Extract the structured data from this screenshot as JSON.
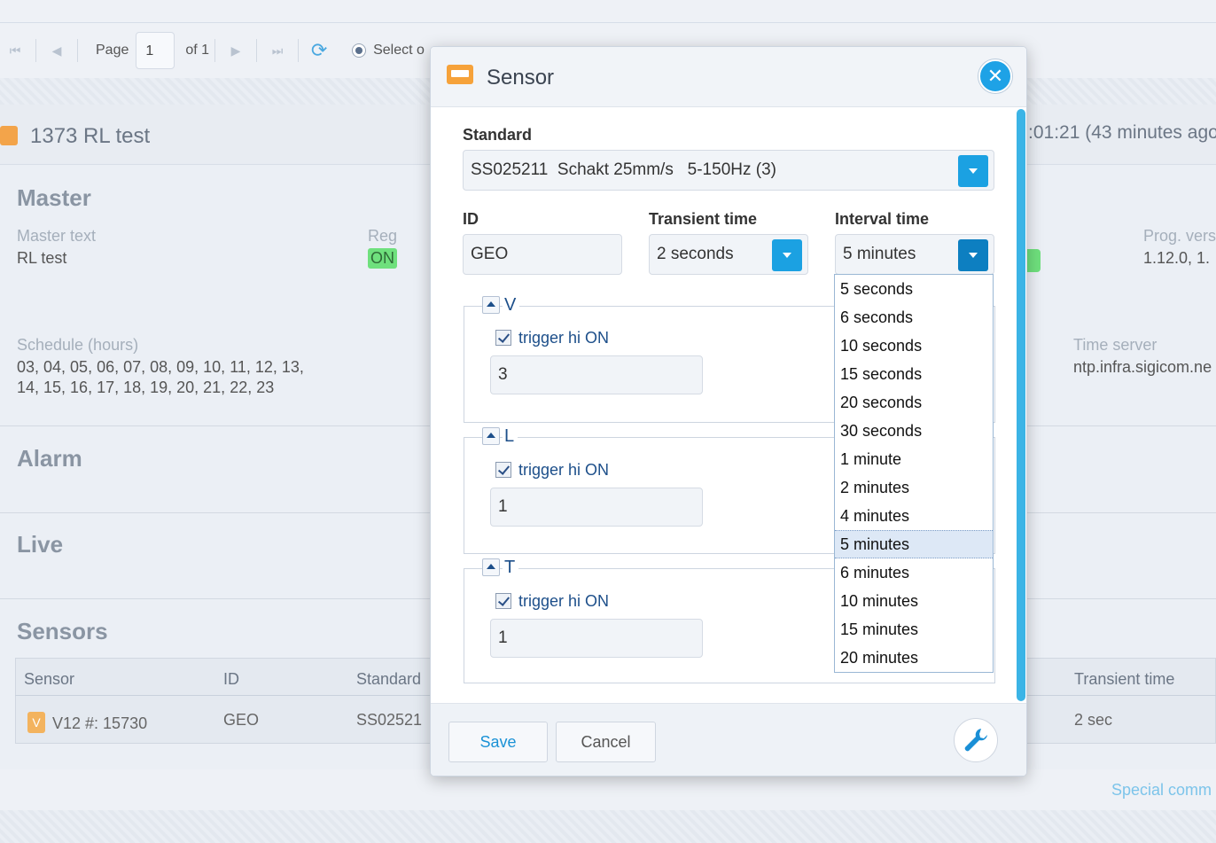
{
  "pager": {
    "page_label": "Page",
    "page_value": "1",
    "of_label": "of 1",
    "select_label": "Select o"
  },
  "device": {
    "title": "1373 RL test",
    "last_seen": ":01:21 (43 minutes ago"
  },
  "sections": {
    "master": "Master",
    "alarm": "Alarm",
    "live": "Live",
    "sensors": "Sensors"
  },
  "master": {
    "text_label": "Master text",
    "text_value": "RL test",
    "reg_label": "Reg",
    "reg_value": "ON",
    "prog_label": "Prog. vers",
    "prog_value": "1.12.0, 1.",
    "schedule_label": "Schedule (hours)",
    "schedule_line1": "03, 04, 05, 06, 07, 08, 09, 10, 11, 12, 13,",
    "schedule_line2": "14, 15, 16, 17, 18, 19, 20, 21, 22, 23",
    "timeserver_label": "Time server",
    "timeserver_value": "ntp.infra.sigicom.ne"
  },
  "sensors_table": {
    "headers": [
      "Sensor",
      "ID",
      "Standard",
      "Transient time"
    ],
    "row": {
      "badge": "V",
      "sensor": "V12 #: 15730",
      "id": "GEO",
      "standard": "SS02521",
      "transient": "2 sec"
    }
  },
  "special_link": "Special comm",
  "dialog": {
    "title": "Sensor",
    "close_glyph": "✕",
    "standard_label": "Standard",
    "standard_value": "SS025211  Schakt 25mm/s   5-150Hz (3)",
    "id_label": "ID",
    "id_value": "GEO",
    "transient_label": "Transient time",
    "transient_value": "2 seconds",
    "interval_label": "Interval time",
    "interval_value": "5 minutes",
    "channels": [
      {
        "name": "V",
        "trigger_label": "trigger hi ON",
        "value": "3"
      },
      {
        "name": "L",
        "trigger_label": "trigger hi ON",
        "value": "1"
      },
      {
        "name": "T",
        "trigger_label": "trigger hi ON",
        "value": "1"
      }
    ],
    "save_label": "Save",
    "cancel_label": "Cancel"
  },
  "interval_options": [
    "5 seconds",
    "6 seconds",
    "10 seconds",
    "15 seconds",
    "20 seconds",
    "30 seconds",
    "1 minute",
    "2 minutes",
    "4 minutes",
    "5 minutes",
    "6 minutes",
    "10 minutes",
    "15 minutes",
    "20 minutes"
  ],
  "interval_selected": "5 minutes",
  "colors": {
    "accent": "#1ba1e2",
    "badge_on": "#6fe07d",
    "sensor_icon": "#f6a23a"
  }
}
